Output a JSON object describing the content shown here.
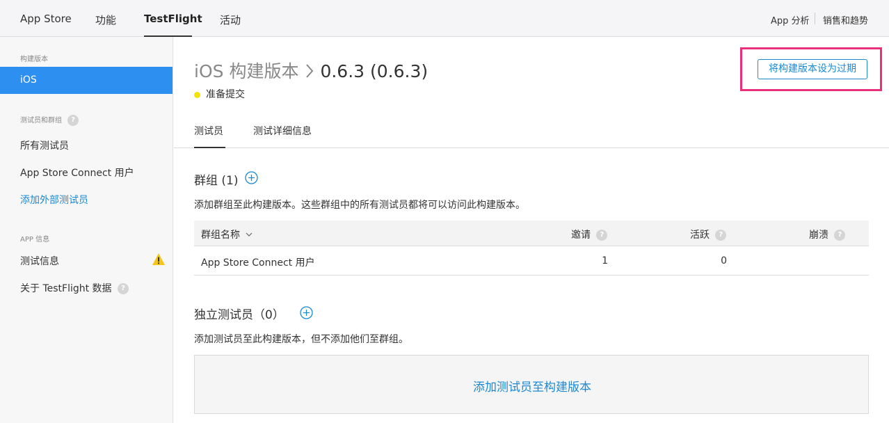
{
  "topnav": {
    "items": [
      "App Store",
      "功能",
      "TestFlight",
      "活动"
    ],
    "right_links": [
      "App 分析",
      "销售和趋势"
    ]
  },
  "sidebar": {
    "section_build": "构建版本",
    "build_ios": "iOS",
    "section_testers": "测试员和群组",
    "all_testers": "所有测试员",
    "asc_users": "App Store Connect 用户",
    "add_external": "添加外部测试员",
    "section_app_info": "APP 信息",
    "test_info": "测试信息",
    "about_testflight": "关于 TestFlight 数据"
  },
  "header": {
    "platform": "iOS 构建版本",
    "separator": ">",
    "version": "0.6.3 (0.6.3)",
    "status": "准备提交",
    "expire_button": "将构建版本设为过期"
  },
  "tabs": [
    "测试员",
    "测试详细信息"
  ],
  "groups": {
    "title": "群组 (1)",
    "description": "添加群组至此构建版本。这些群组中的所有测试员都将可以访问此构建版本。",
    "columns": [
      "群组名称",
      "邀请",
      "活跃",
      "崩溃"
    ],
    "rows": [
      {
        "name": "App Store Connect 用户",
        "invites": "1",
        "active": "0",
        "crashes": ""
      }
    ]
  },
  "individual": {
    "title": "独立测试员（0）",
    "description": "添加测试员至此构建版本，但不添加他们至群组。",
    "add_button": "添加测试员至构建版本"
  },
  "colors": {
    "accent": "#1a8ad5",
    "selected": "#2d8ff0",
    "status_dot": "#f2e200",
    "highlight_frame": "#e8317a",
    "warning": "#f5c518"
  },
  "icons": {
    "help": "question-icon",
    "warning": "warning-icon",
    "add": "plus-circle-icon",
    "sort": "chevron-down-icon",
    "breadcrumb": "chevron-right-icon"
  }
}
